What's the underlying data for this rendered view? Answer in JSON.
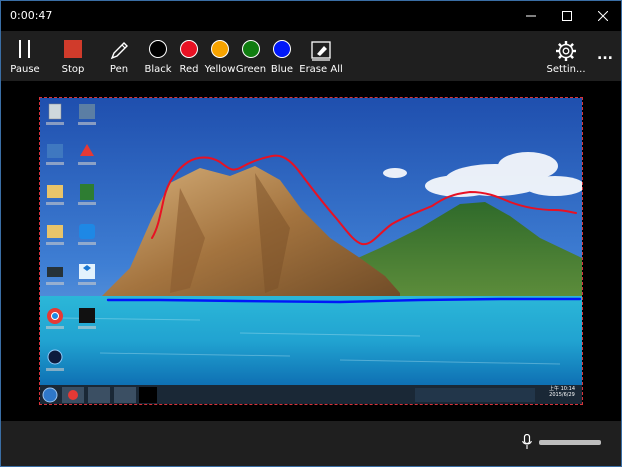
{
  "window": {
    "timer": "0:00:47",
    "minimize_icon": "minimize-icon",
    "maximize_icon": "maximize-icon",
    "close_icon": "close-icon"
  },
  "toolbar": {
    "pause_label": "Pause",
    "stop_label": "Stop",
    "pen_label": "Pen",
    "black_label": "Black",
    "red_label": "Red",
    "yellow_label": "Yellow",
    "green_label": "Green",
    "blue_label": "Blue",
    "erase_label": "Erase All",
    "settings_label": "Settin...",
    "more_label": "..."
  },
  "colors": {
    "black": "#000000",
    "red": "#e81123",
    "yellow": "#f7a300",
    "green": "#107c10",
    "blue": "#0018f9",
    "stop": "#d03b2b",
    "selection_border": "#d8323a"
  },
  "desktop": {
    "clock_time": "上午 10:14",
    "clock_date": "2015/6/29"
  },
  "bottom": {
    "mic_icon": "microphone-icon"
  }
}
